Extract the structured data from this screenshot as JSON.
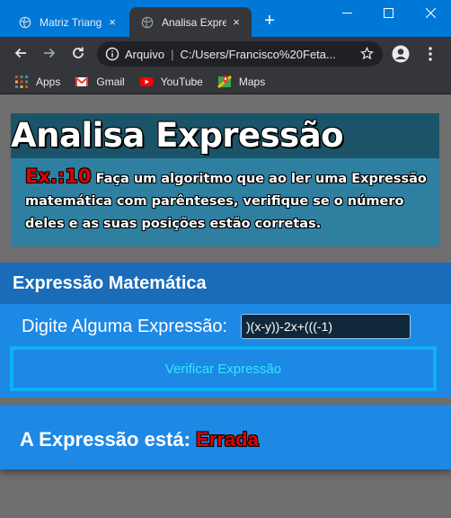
{
  "browser": {
    "tabs": [
      {
        "label": "Matriz Triangula",
        "close": "×"
      },
      {
        "label": "Analisa Expressã",
        "close": "×"
      }
    ],
    "new_tab": "+",
    "address": {
      "site_label": "Arquivo",
      "separator": "|",
      "url": "C:/Users/Francisco%20Feta..."
    },
    "bookmarks": [
      {
        "label": "Apps",
        "icon": "apps-grid-icon"
      },
      {
        "label": "Gmail",
        "icon": "gmail-icon"
      },
      {
        "label": "YouTube",
        "icon": "youtube-icon"
      },
      {
        "label": "Maps",
        "icon": "maps-icon"
      }
    ]
  },
  "header": {
    "title": "Analisa Expressão",
    "exercise_tag": "Ex.:10",
    "description": "Faça um algoritmo que ao ler uma Expressão matemática com parênteses, verifique se o número deles e as suas posições estão corretas."
  },
  "form": {
    "section_title": "Expressão Matemática",
    "label": "Digite Alguma Expressão:",
    "input_value": ")(x-y))-2x+(((-1)",
    "button_label": "Verificar Expressão"
  },
  "result": {
    "prefix": "A Expressão está:",
    "value": "Errada"
  },
  "colors": {
    "titlebar": "#0078d7",
    "chrome_dark": "#35363a",
    "page_bg": "#6e6e6e",
    "header_dark": "#1b5468",
    "header_body": "#2e7fa0",
    "form_bg": "#1e88e5",
    "form_head": "#1a6cb8",
    "button_border": "#0db2f5",
    "button_text": "#2ee8ff",
    "error_red": "#e00000"
  }
}
